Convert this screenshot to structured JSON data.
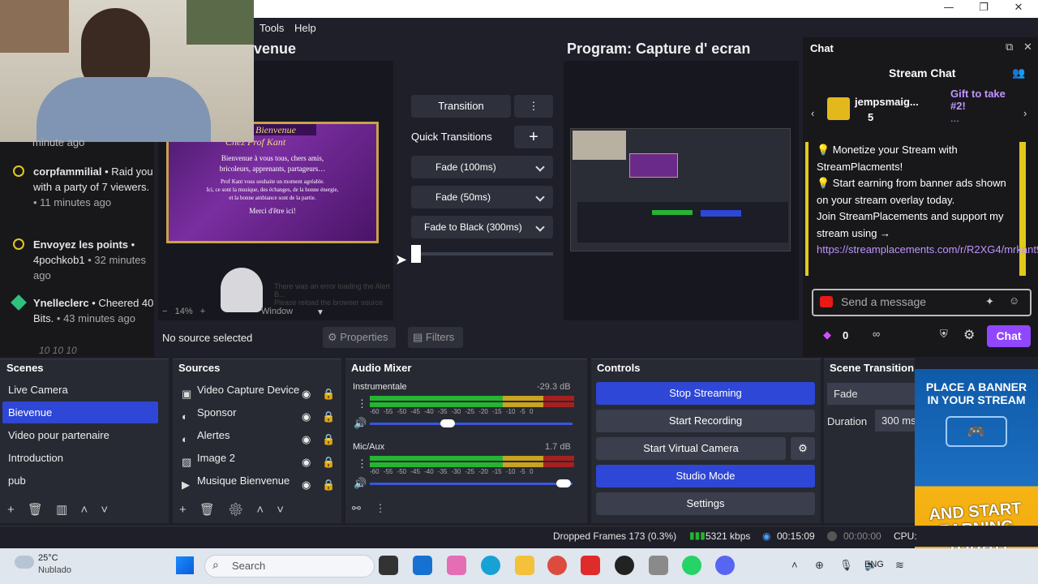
{
  "window": {
    "minimize": "—",
    "maximize": "❐",
    "close": "✕"
  },
  "menu": {
    "tools": "Tools",
    "help": "Help"
  },
  "preview": {
    "title_fragment": "venue",
    "zoom": "14%",
    "zoom_mode": "Window",
    "error_line1": "There was an error loading the Alert B...",
    "error_line2": "Please reload the browser source"
  },
  "program": {
    "title": "Program: Capture d' ecran"
  },
  "banner": {
    "title": "Bienvenue",
    "subtitle": "Chez Prof Kant",
    "line1": "Bienvenue à vous tous, chers amis,",
    "line2": "bricoleurs, apprenants, partageurs…",
    "line3": "Prof Kant vous souhaite un moment agréable.",
    "line4": "Ici, ce sont la musique, des échanges, de la bonne énergie,",
    "line5": "et la bonne ambiance sont de la partie.",
    "line6": "Merci d'être ici!"
  },
  "transitions": {
    "transition": "Transition",
    "quick": "Quick Transitions",
    "fade100": "Fade (100ms)",
    "fade50": "Fade (50ms)",
    "fadeblack": "Fade to Black (300ms)"
  },
  "feed": {
    "items": [
      {
        "text": "minute ago"
      },
      {
        "name": "corpfammilial",
        "rest": " • Raid you with a party of 7 viewers.",
        "time": " • 11 minutes ago"
      },
      {
        "name": "Envoyez les points",
        "rest": " • 4pochkob1",
        "time": " • 32 minutes ago"
      },
      {
        "name": "Ynelleclerc",
        "rest": " • Cheered 40 Bits.",
        "time": " • 43 minutes ago"
      }
    ],
    "footer": "10  10  10"
  },
  "chat": {
    "dock_title": "Chat",
    "header": "Stream Chat",
    "user": "jempsmaig...",
    "gift_count": "5",
    "gift_text": "Gift to take #2!",
    "gift_more": "...",
    "msg1": "💡 Monetize your Stream with StreamPlacments!",
    "msg2": "💡 Start earning from banner ads shown on your stream overlay today.",
    "msg3": "Join StreamPlacements and support my stream using →",
    "link": "https://streamplacements.com/r/R2XG4/mrkant90/",
    "input_placeholder": "Send a message",
    "points": "0",
    "infinity": "∞",
    "chat_button": "Chat"
  },
  "toolbar": {
    "no_source": "No source selected",
    "properties": "Properties",
    "filters": "Filters"
  },
  "scenes": {
    "title": "Scenes",
    "items": [
      "Live Camera",
      "Bievenue",
      "Video pour partenaire",
      "Introduction",
      "pub"
    ],
    "selected": 1
  },
  "sources": {
    "title": "Sources",
    "items": [
      "Video Capture Device",
      "Sponsor",
      "Alertes",
      "Image 2",
      "Musique Bienvenue"
    ]
  },
  "mixer": {
    "title": "Audio Mixer",
    "ch1": "Instrumentale",
    "ch1_db": "-29.3 dB",
    "ch2": "Mic/Aux",
    "ch2_db": "1.7 dB",
    "scale": "-60 -55 -50 -45 -40 -35 -30 -25 -20 -15 -10 -5 0"
  },
  "controls": {
    "title": "Controls",
    "stop": "Stop Streaming",
    "record": "Start Recording",
    "vcam": "Start Virtual Camera",
    "studio": "Studio Mode",
    "settings": "Settings"
  },
  "scene_trans": {
    "title": "Scene Transitions",
    "fade": "Fade",
    "duration_label": "Duration",
    "duration": "300 ms"
  },
  "ad": {
    "top": "PLACE A BANNER IN YOUR STREAM",
    "bottom": "AND START EARNING TODAY!"
  },
  "status": {
    "dropped": "Dropped Frames 173 (0.3%)",
    "kbps": "5321 kbps",
    "live": "00:15:09",
    "rec": "00:00:00",
    "cpu": "CPU:"
  },
  "taskbar": {
    "temp": "25°C",
    "weather": "Nublado",
    "search": "Search",
    "lang": "ENG"
  }
}
